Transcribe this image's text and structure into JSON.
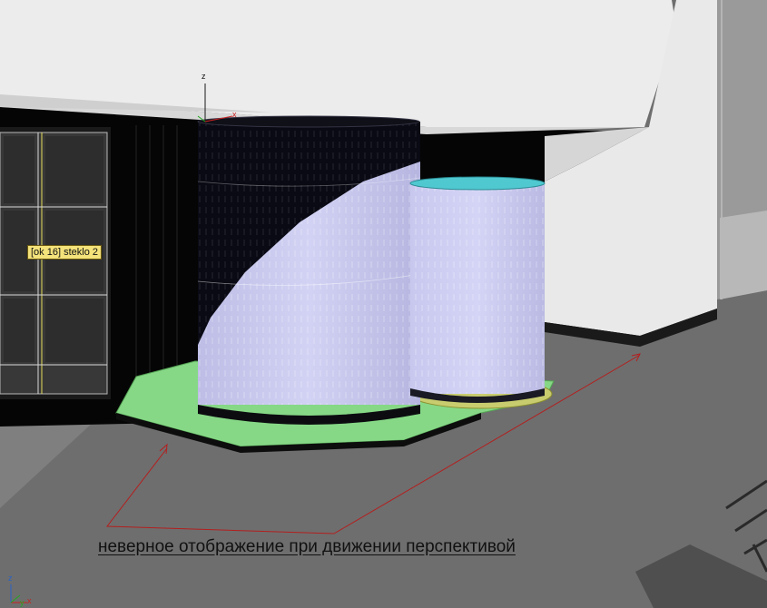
{
  "viewport": {
    "object_tooltip": "[ok 16] steklo 2",
    "annotation_text": "неверное отображение при движении перспективой",
    "gizmo": {
      "z_label": "z",
      "x_label": "x"
    },
    "corner_axes": {
      "z_label": "z",
      "x_label": "x",
      "y_label": "y"
    }
  },
  "colors": {
    "background": "#6e6e6e",
    "ceiling": "#ececec",
    "cylinder": "#c7c7ee",
    "base_platform": "#86d886",
    "annotation_arrows": "#b41e1e",
    "tooltip_bg": "#f4e27a"
  }
}
